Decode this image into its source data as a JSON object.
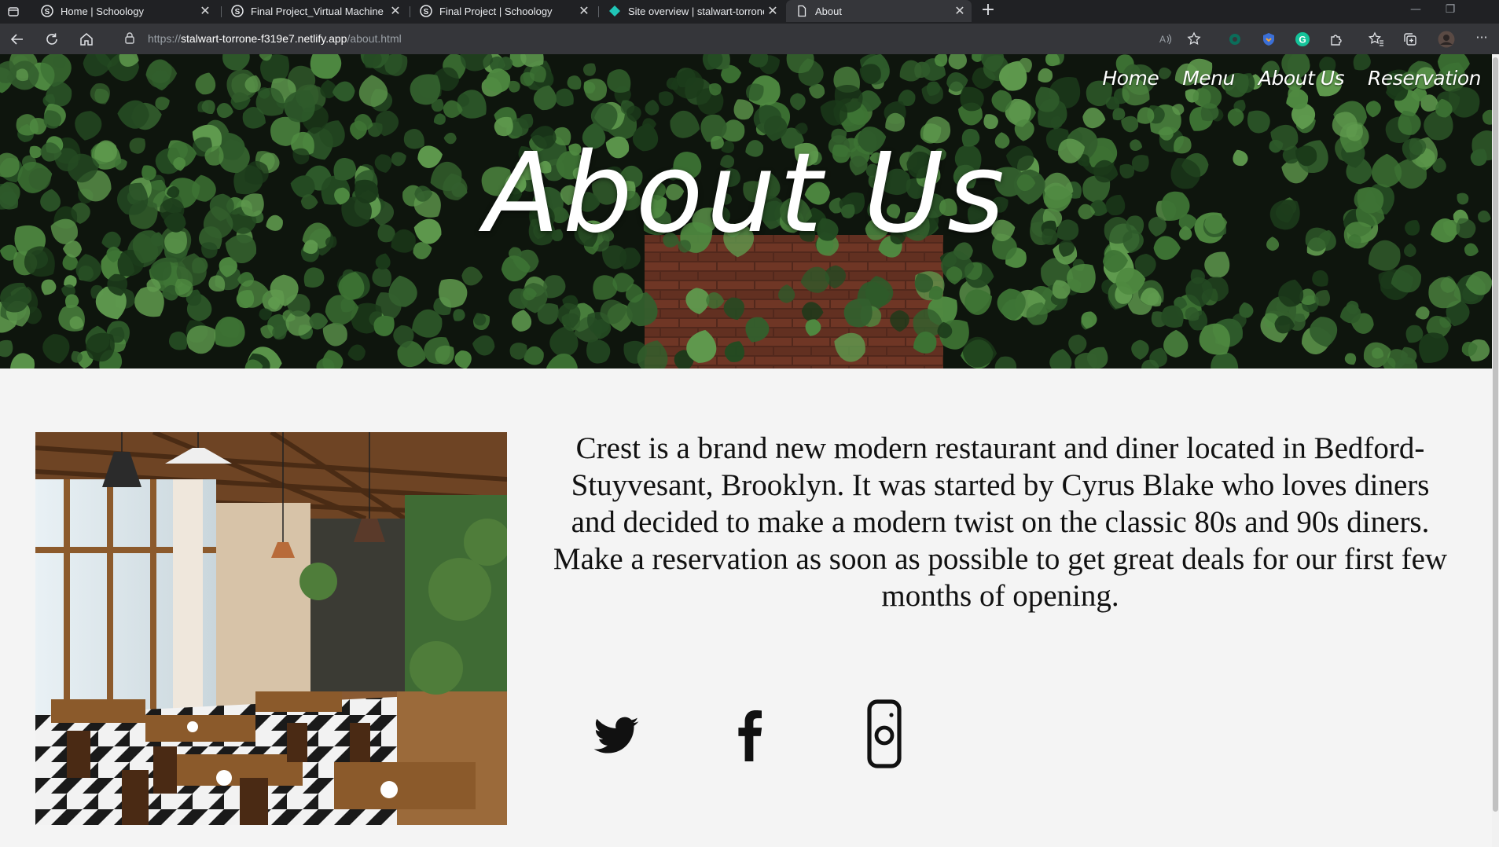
{
  "browser": {
    "tabs": [
      {
        "title": "Home | Schoology",
        "favicon": "schoology-icon"
      },
      {
        "title": "Final Project_Virtual Machine | Sc",
        "favicon": "schoology-icon"
      },
      {
        "title": "Final Project | Schoology",
        "favicon": "schoology-icon"
      },
      {
        "title": "Site overview | stalwart-torrone-",
        "favicon": "netlify-icon"
      },
      {
        "title": "About",
        "favicon": "page-icon",
        "active": true
      }
    ],
    "close_glyph": "✕",
    "new_tab_glyph": "+",
    "url": {
      "prefix": "https://",
      "host": "stalwart-torrone-f319e7.netlify.app",
      "path": "/about.html"
    },
    "controls": {
      "minimize": "—",
      "restore": "❐",
      "more": "···"
    }
  },
  "site": {
    "nav": [
      "Home",
      "Menu",
      "About Us",
      "Reservation"
    ],
    "hero_title": "About Us",
    "about_paragraph": "Crest is a brand new modern restaurant and diner located in Bedford-Stuyvesant, Brooklyn. It was started by Cyrus Blake who loves diners and decided to make a modern twist on the classic 80s and 90s diners. Make a reservation as soon as possible to get great deals for our first few months of opening.",
    "social": [
      "twitter-icon",
      "facebook-icon",
      "instagram-icon"
    ]
  },
  "colors": {
    "chrome_dark": "#202124",
    "chrome_toolbar": "#35363a",
    "page_bg": "#f4f4f4",
    "ivy_green": "#2e5a2a",
    "brick_red": "#6e3626"
  }
}
